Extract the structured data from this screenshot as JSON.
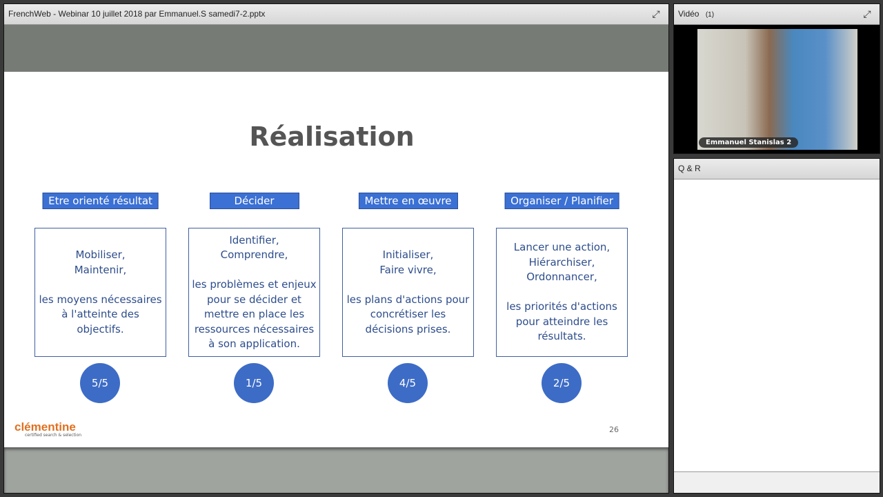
{
  "presentation_pod": {
    "title": "FrenchWeb - Webinar 10 juillet 2018 par Emmanuel.S samedi7-2.pptx"
  },
  "slide": {
    "title": "Réalisation",
    "columns": [
      {
        "header": "Etre orienté résultat",
        "body": "Mobiliser,\nMaintenir,\n\nles moyens nécessaires à l'atteinte des objectifs.",
        "score": "5/5"
      },
      {
        "header": "Décider",
        "body": "Identifier,\nComprendre,\n\nles problèmes et enjeux pour se décider et mettre en place les ressources nécessaires à son application.",
        "score": "1/5"
      },
      {
        "header": "Mettre en œuvre",
        "body": "Initialiser,\nFaire vivre,\n\nles plans d'actions pour concrétiser les décisions prises.",
        "score": "4/5"
      },
      {
        "header": "Organiser / Planifier",
        "body": "Lancer une action,\nHiérarchiser,\nOrdonnancer,\n\nles priorités d'actions pour atteindre les résultats.",
        "score": "2/5"
      }
    ],
    "logo": "clémentine",
    "logo_tagline": "certified search & selection",
    "page_number": "26"
  },
  "video_pod": {
    "title": "Vidéo",
    "count": "(1)",
    "participant": "Emmanuel Stanislas 2"
  },
  "qa_pod": {
    "title": "Q & R"
  }
}
